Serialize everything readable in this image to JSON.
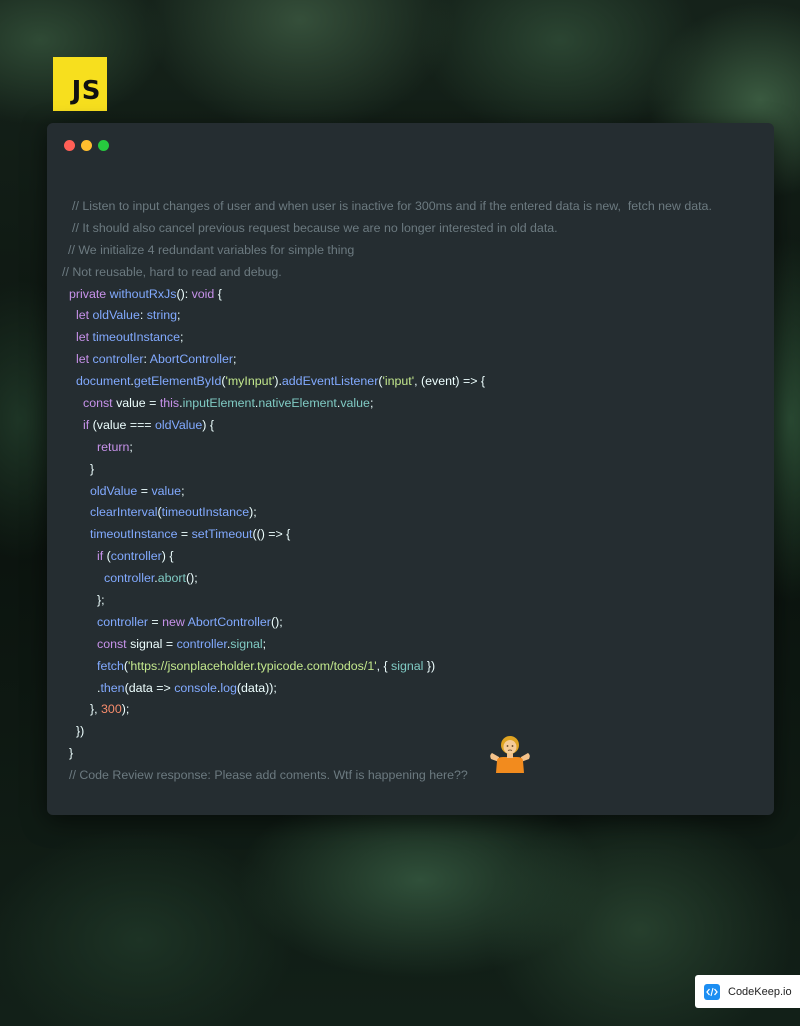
{
  "logo": {
    "text": "JS",
    "color": "#f7df1e"
  },
  "window": {
    "controls": [
      "close-dot",
      "minimize-dot",
      "zoom-dot"
    ],
    "background": "#252d31"
  },
  "code": {
    "lines": [
      {
        "indent": 25,
        "tokens": [
          {
            "t": "comment",
            "v": "// Listen to input changes of user and when user is inactive for 300ms and if the entered data is new,  fetch new data."
          }
        ]
      },
      {
        "indent": 25,
        "tokens": [
          {
            "t": "comment",
            "v": "// It should also cancel previous request because we are no longer interested in old data."
          }
        ]
      },
      {
        "indent": 21,
        "tokens": [
          {
            "t": "comment",
            "v": "// We initialize 4 redundant variables for simple thing"
          }
        ]
      },
      {
        "indent": 15,
        "tokens": [
          {
            "t": "comment",
            "v": "// Not reusable, hard to read and debug."
          }
        ]
      },
      {
        "indent": 22,
        "tokens": [
          {
            "t": "keyword",
            "v": "private "
          },
          {
            "t": "func",
            "v": "withoutRxJs"
          },
          {
            "t": "plain",
            "v": "(): "
          },
          {
            "t": "keyword",
            "v": "void"
          },
          {
            "t": "plain",
            "v": " {"
          }
        ]
      },
      {
        "indent": 29,
        "tokens": [
          {
            "t": "keyword",
            "v": "let "
          },
          {
            "t": "func",
            "v": "oldValue"
          },
          {
            "t": "plain",
            "v": ": "
          },
          {
            "t": "type",
            "v": "string"
          },
          {
            "t": "plain",
            "v": ";"
          }
        ]
      },
      {
        "indent": 29,
        "tokens": [
          {
            "t": "keyword",
            "v": "let "
          },
          {
            "t": "func",
            "v": "timeoutInstance"
          },
          {
            "t": "plain",
            "v": ";"
          }
        ]
      },
      {
        "indent": 29,
        "tokens": [
          {
            "t": "keyword",
            "v": "let "
          },
          {
            "t": "func",
            "v": "controller"
          },
          {
            "t": "plain",
            "v": ": "
          },
          {
            "t": "type",
            "v": "AbortController"
          },
          {
            "t": "plain",
            "v": ";"
          }
        ]
      },
      {
        "indent": 29,
        "tokens": [
          {
            "t": "func",
            "v": "document"
          },
          {
            "t": "plain",
            "v": "."
          },
          {
            "t": "func",
            "v": "getElementById"
          },
          {
            "t": "plain",
            "v": "("
          },
          {
            "t": "string",
            "v": "'myInput'"
          },
          {
            "t": "plain",
            "v": ")."
          },
          {
            "t": "func",
            "v": "addEventListener"
          },
          {
            "t": "plain",
            "v": "("
          },
          {
            "t": "string",
            "v": "'input'"
          },
          {
            "t": "plain",
            "v": ", (event) => {"
          }
        ]
      },
      {
        "indent": 36,
        "tokens": [
          {
            "t": "keyword",
            "v": "const "
          },
          {
            "t": "plain",
            "v": "value = "
          },
          {
            "t": "keyword",
            "v": "this"
          },
          {
            "t": "plain",
            "v": "."
          },
          {
            "t": "prop",
            "v": "inputElement"
          },
          {
            "t": "plain",
            "v": "."
          },
          {
            "t": "prop",
            "v": "nativeElement"
          },
          {
            "t": "plain",
            "v": "."
          },
          {
            "t": "prop",
            "v": "value"
          },
          {
            "t": "plain",
            "v": ";"
          }
        ]
      },
      {
        "indent": 36,
        "tokens": [
          {
            "t": "keyword",
            "v": "if "
          },
          {
            "t": "plain",
            "v": "(value === "
          },
          {
            "t": "func",
            "v": "oldValue"
          },
          {
            "t": "plain",
            "v": ") {"
          }
        ]
      },
      {
        "indent": 50,
        "tokens": [
          {
            "t": "keyword",
            "v": "return"
          },
          {
            "t": "plain",
            "v": ";"
          }
        ]
      },
      {
        "indent": 43,
        "tokens": [
          {
            "t": "plain",
            "v": "}"
          }
        ]
      },
      {
        "indent": 43,
        "tokens": [
          {
            "t": "func",
            "v": "oldValue"
          },
          {
            "t": "plain",
            "v": " = "
          },
          {
            "t": "func",
            "v": "value"
          },
          {
            "t": "plain",
            "v": ";"
          }
        ]
      },
      {
        "indent": 43,
        "tokens": [
          {
            "t": "func",
            "v": "clearInterval"
          },
          {
            "t": "plain",
            "v": "("
          },
          {
            "t": "func",
            "v": "timeoutInstance"
          },
          {
            "t": "plain",
            "v": ");"
          }
        ]
      },
      {
        "indent": 43,
        "tokens": [
          {
            "t": "func",
            "v": "timeoutInstance"
          },
          {
            "t": "plain",
            "v": " = "
          },
          {
            "t": "func",
            "v": "setTimeout"
          },
          {
            "t": "plain",
            "v": "(() => {"
          }
        ]
      },
      {
        "indent": 50,
        "tokens": [
          {
            "t": "keyword",
            "v": "if "
          },
          {
            "t": "plain",
            "v": "("
          },
          {
            "t": "func",
            "v": "controller"
          },
          {
            "t": "plain",
            "v": ") {"
          }
        ]
      },
      {
        "indent": 57,
        "tokens": [
          {
            "t": "func",
            "v": "controller"
          },
          {
            "t": "plain",
            "v": "."
          },
          {
            "t": "prop",
            "v": "abort"
          },
          {
            "t": "plain",
            "v": "();"
          }
        ]
      },
      {
        "indent": 50,
        "tokens": [
          {
            "t": "plain",
            "v": "};"
          }
        ]
      },
      {
        "indent": 50,
        "tokens": [
          {
            "t": "func",
            "v": "controller"
          },
          {
            "t": "plain",
            "v": " = "
          },
          {
            "t": "keyword",
            "v": "new "
          },
          {
            "t": "type",
            "v": "AbortController"
          },
          {
            "t": "plain",
            "v": "();"
          }
        ]
      },
      {
        "indent": 50,
        "tokens": [
          {
            "t": "keyword",
            "v": "const "
          },
          {
            "t": "plain",
            "v": "signal = "
          },
          {
            "t": "func",
            "v": "controller"
          },
          {
            "t": "plain",
            "v": "."
          },
          {
            "t": "prop",
            "v": "signal"
          },
          {
            "t": "plain",
            "v": ";"
          }
        ]
      },
      {
        "indent": 50,
        "tokens": [
          {
            "t": "func",
            "v": "fetch"
          },
          {
            "t": "plain",
            "v": "("
          },
          {
            "t": "string",
            "v": "'https://jsonplaceholder.typicode.com/todos/1'"
          },
          {
            "t": "plain",
            "v": ", { "
          },
          {
            "t": "prop",
            "v": "signal"
          },
          {
            "t": "plain",
            "v": " })"
          }
        ]
      },
      {
        "indent": 50,
        "tokens": [
          {
            "t": "plain",
            "v": "."
          },
          {
            "t": "func",
            "v": "then"
          },
          {
            "t": "plain",
            "v": "(data => "
          },
          {
            "t": "func",
            "v": "console"
          },
          {
            "t": "plain",
            "v": "."
          },
          {
            "t": "func",
            "v": "log"
          },
          {
            "t": "plain",
            "v": "(data));"
          }
        ]
      },
      {
        "indent": 43,
        "tokens": [
          {
            "t": "plain",
            "v": "}, "
          },
          {
            "t": "number",
            "v": "300"
          },
          {
            "t": "plain",
            "v": ");"
          }
        ]
      },
      {
        "indent": 29,
        "tokens": [
          {
            "t": "plain",
            "v": "})"
          }
        ]
      },
      {
        "indent": 22,
        "tokens": [
          {
            "t": "plain",
            "v": "}"
          }
        ]
      },
      {
        "indent": 22,
        "tokens": [
          {
            "t": "comment",
            "v": "// Code Review response: Please add coments. Wtf is happening here??"
          }
        ]
      }
    ]
  },
  "emoji": {
    "name": "person-shrugging-icon"
  },
  "badge": {
    "label": "CodeKeep.io",
    "icon": "code-icon",
    "color": "#1c8ef2"
  }
}
